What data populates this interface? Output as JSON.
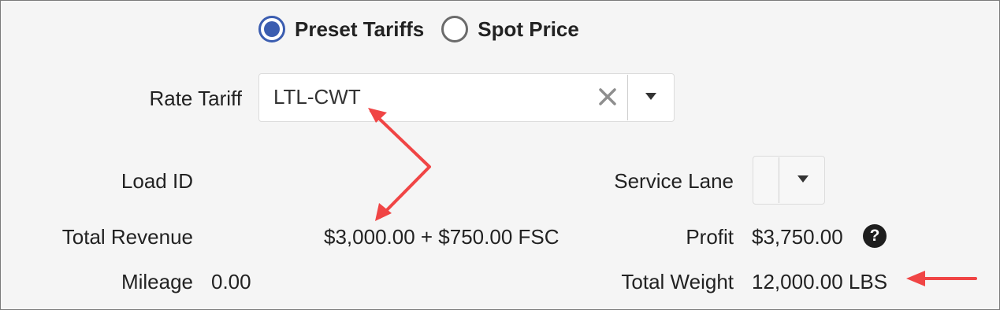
{
  "pricing_mode": {
    "options": [
      {
        "label": "Preset Tariffs",
        "selected": true
      },
      {
        "label": "Spot Price",
        "selected": false
      }
    ]
  },
  "rate_tariff": {
    "label": "Rate Tariff",
    "value": "LTL-CWT"
  },
  "load_id": {
    "label": "Load ID",
    "value": ""
  },
  "service_lane": {
    "label": "Service Lane",
    "value": ""
  },
  "total_revenue": {
    "label": "Total Revenue",
    "value": "$3,000.00 + $750.00 FSC"
  },
  "profit": {
    "label": "Profit",
    "value": "$3,750.00",
    "help_icon": "?"
  },
  "mileage": {
    "label": "Mileage",
    "value": "0.00"
  },
  "total_weight": {
    "label": "Total Weight",
    "value": "12,000.00 LBS"
  },
  "colors": {
    "radio_selected": "#3b5db0",
    "annotation_arrow": "#f04545",
    "background": "#f5f5f5"
  }
}
